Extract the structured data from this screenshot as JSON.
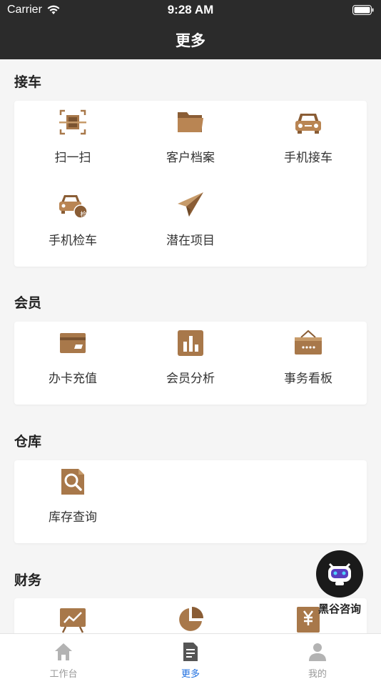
{
  "status_bar": {
    "carrier": "Carrier",
    "time": "9:28 AM"
  },
  "nav": {
    "title": "更多"
  },
  "sections": [
    {
      "title": "接车",
      "items": [
        {
          "label": "扫一扫",
          "icon": "scan-icon"
        },
        {
          "label": "客户档案",
          "icon": "folder-icon"
        },
        {
          "label": "手机接车",
          "icon": "car-icon"
        },
        {
          "label": "手机检车",
          "icon": "car-inspect-icon",
          "badge": "检"
        },
        {
          "label": "潜在项目",
          "icon": "paper-plane-icon"
        }
      ]
    },
    {
      "title": "会员",
      "items": [
        {
          "label": "办卡充值",
          "icon": "card-icon"
        },
        {
          "label": "会员分析",
          "icon": "bar-chart-icon"
        },
        {
          "label": "事务看板",
          "icon": "board-icon"
        }
      ]
    },
    {
      "title": "仓库",
      "items": [
        {
          "label": "库存查询",
          "icon": "search-document-icon"
        }
      ]
    },
    {
      "title": "财务",
      "items": [
        {
          "label": "",
          "icon": "presentation-chart-icon"
        },
        {
          "label": "",
          "icon": "pie-chart-icon"
        },
        {
          "label": "",
          "icon": "yuan-document-icon"
        }
      ]
    }
  ],
  "floating": {
    "label": "黑谷咨询",
    "icon": "robot-icon"
  },
  "tabs": [
    {
      "label": "工作台",
      "icon": "home-icon",
      "active": false
    },
    {
      "label": "更多",
      "icon": "document-icon",
      "active": true
    },
    {
      "label": "我的",
      "icon": "person-icon",
      "active": false
    }
  ],
  "colors": {
    "accent": "#1f6fe0",
    "icon_brown": "#a8784a",
    "header": "#2b2b2b"
  }
}
